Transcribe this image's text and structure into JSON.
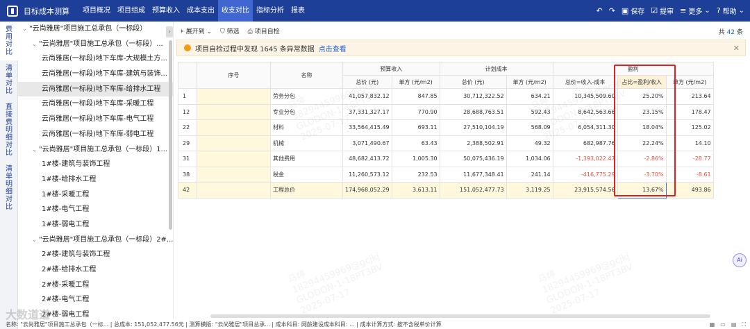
{
  "app": {
    "title": "目标成本测算",
    "logo_icon": "app-logo-icon"
  },
  "menu": [
    "项目概况",
    "项目组成",
    "预算收入",
    "成本支出",
    "收支对比",
    "指标分析",
    "报表"
  ],
  "menu_active_index": 4,
  "topright": {
    "save": "保存",
    "submit": "提审",
    "more": "更多",
    "help": "帮助"
  },
  "vtabs": [
    "费用对比",
    "清单对比",
    "直接费明细对比",
    "清单明细对比"
  ],
  "tree": [
    {
      "label": "\"云尚雅居\"项目施工总承包（一标段）",
      "level": 0,
      "caret": true
    },
    {
      "label": "\"云尚雅居\"项目施工总承包（一标段）...",
      "level": 1,
      "caret": true
    },
    {
      "label": "云尚雅居(一标段)地下车库-大规模土方...",
      "level": 2
    },
    {
      "label": "云尚雅居(一标段)地下车库-建筑与装饰...",
      "level": 2
    },
    {
      "label": "云尚雅居(一标段)地下车库-给排水工程",
      "level": 2,
      "selected": true
    },
    {
      "label": "云尚雅居(一标段)地下车库-采暖工程",
      "level": 2
    },
    {
      "label": "云尚雅居(一标段)地下车库-电气工程",
      "level": 2
    },
    {
      "label": "云尚雅居(一标段)地下车库-弱电工程",
      "level": 2
    },
    {
      "label": "\"云尚雅居\"项目施工总承包（一标段）1...",
      "level": 1,
      "caret": true
    },
    {
      "label": "1#楼-建筑与装饰工程",
      "level": 2
    },
    {
      "label": "1#楼-给排水工程",
      "level": 2
    },
    {
      "label": "1#楼-采暖工程",
      "level": 2
    },
    {
      "label": "1#楼-电气工程",
      "level": 2
    },
    {
      "label": "1#楼-弱电工程",
      "level": 2
    },
    {
      "label": "\"云尚雅居\"项目施工总承包（一标段）2#...",
      "level": 1,
      "caret": true
    },
    {
      "label": "2#楼-建筑与装饰工程",
      "level": 2
    },
    {
      "label": "2#楼-给排水工程",
      "level": 2
    },
    {
      "label": "2#楼-采暖工程",
      "level": 2
    },
    {
      "label": "2#楼-电气工程",
      "level": 2
    },
    {
      "label": "2#楼-弱电工程",
      "level": 2
    }
  ],
  "toolbar": {
    "expand": "展开到",
    "filter": "筛选",
    "check": "项目自检",
    "count_prefix": "共",
    "count": "42",
    "count_suffix": "条"
  },
  "alert": {
    "text": "项目自检过程中发现 1645 条异常数据",
    "link": "点击查看"
  },
  "table": {
    "group_headers": [
      "预算收入",
      "计划成本",
      "盈利"
    ],
    "headers": {
      "seq": "序号",
      "name": "名称",
      "total": "总价 (元)",
      "unit": "单方 (元/m2)",
      "profit_total": "总价=收入-成本",
      "ratio": "占比=盈利/收入"
    },
    "rows": [
      {
        "idx": "1",
        "name": "劳务分包",
        "inc_total": "41,057,832.12",
        "inc_unit": "847.85",
        "cost_total": "30,712,322.52",
        "cost_unit": "634.21",
        "p_total": "10,345,509.60",
        "ratio": "25.20%",
        "p_unit": "213.64",
        "neg": false
      },
      {
        "idx": "12",
        "name": "专业分包",
        "inc_total": "37,331,327.17",
        "inc_unit": "770.90",
        "cost_total": "28,688,763.51",
        "cost_unit": "592.43",
        "p_total": "8,642,563.66",
        "ratio": "23.15%",
        "p_unit": "178.47",
        "neg": false
      },
      {
        "idx": "22",
        "name": "材料",
        "inc_total": "33,564,415.49",
        "inc_unit": "693.11",
        "cost_total": "27,510,104.19",
        "cost_unit": "568.09",
        "p_total": "6,054,311.30",
        "ratio": "18.04%",
        "p_unit": "125.02",
        "neg": false
      },
      {
        "idx": "29",
        "name": "机械",
        "inc_total": "3,071,490.67",
        "inc_unit": "63.43",
        "cost_total": "2,388,502.91",
        "cost_unit": "49.32",
        "p_total": "682,987.76",
        "ratio": "22.24%",
        "p_unit": "14.10",
        "neg": false
      },
      {
        "idx": "31",
        "name": "其他费用",
        "inc_total": "48,682,413.72",
        "inc_unit": "1,005.30",
        "cost_total": "50,075,436.19",
        "cost_unit": "1,034.06",
        "p_total": "-1,393,022.47",
        "ratio": "-2.86%",
        "p_unit": "-28.77",
        "neg": true
      },
      {
        "idx": "38",
        "name": "税金",
        "inc_total": "11,260,573.12",
        "inc_unit": "232.53",
        "cost_total": "11,677,348.41",
        "cost_unit": "241.14",
        "p_total": "-416,775.29",
        "ratio": "-3.70%",
        "p_unit": "-8.61",
        "neg": true
      },
      {
        "idx": "42",
        "name": "工程总价",
        "inc_total": "174,968,052.29",
        "inc_unit": "3,613.11",
        "cost_total": "151,052,477.73",
        "cost_unit": "3,119.25",
        "p_total": "23,915,574.56",
        "ratio": "13.67%",
        "p_unit": "493.86",
        "neg": false,
        "total": true
      }
    ]
  },
  "watermark": [
    "马婷",
    "18294459969@gcjkj",
    "GLODON-1-18PT3BV",
    "2025-07-17"
  ],
  "statusbar": "名称: \"云尚雅居\"项目施工总承包（一标... | 总成本: 151,052,477.56元 | 测算模版: \"云尚雅居\"项目总承... | 成本科目: 网龄建设成本科目: ... | 成本计算方式: 按不含税单价计算",
  "brand": "大数道道",
  "ai_label": "Ai",
  "colors": {
    "topbar": "#1d3f97",
    "active_menu": "#3f66d1",
    "negative": "#e74c3c",
    "highlight_box": "#e02020",
    "link": "#1d62d8"
  }
}
